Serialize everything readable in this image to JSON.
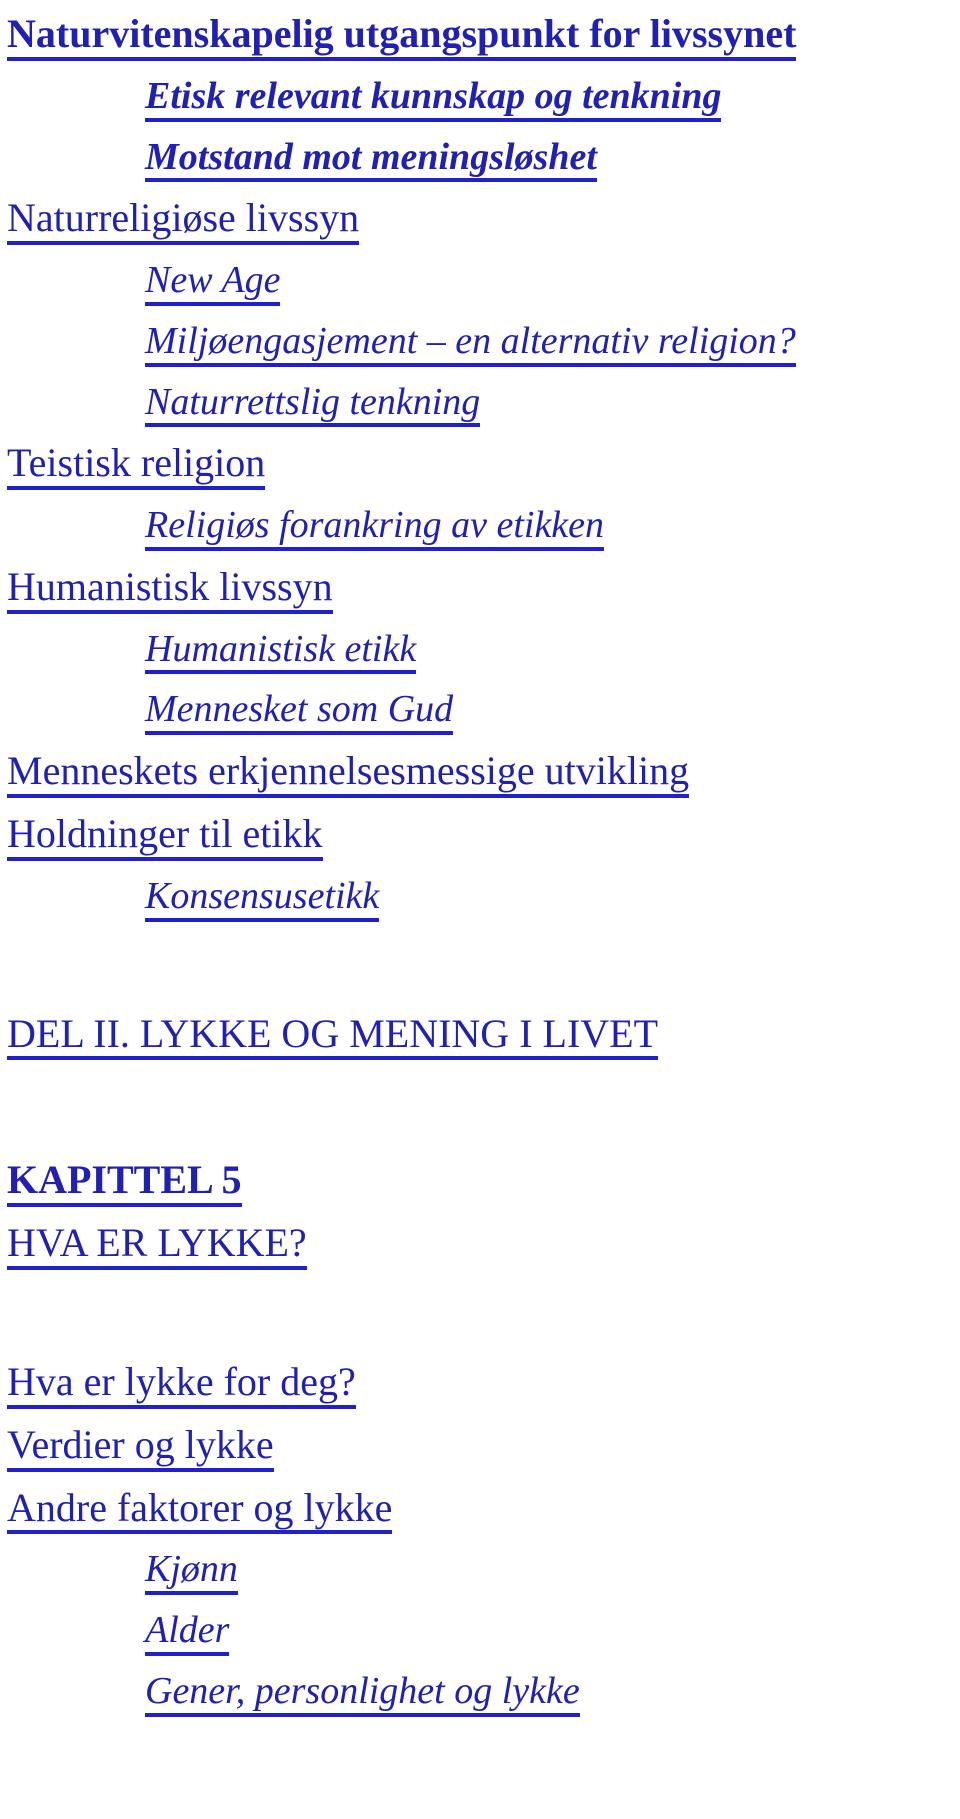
{
  "document": {
    "type": "table-of-contents",
    "language": "no",
    "text_color": "#2020b4",
    "underline_color": "#2020ce",
    "background_color": "#ffffff"
  },
  "entries": [
    {
      "text": "Naturvitenskapelig utgangspunkt for livssynet",
      "level": 0,
      "style": "bold",
      "gap": "first"
    },
    {
      "text": "Etisk relevant kunnskap og tenkning",
      "level": 1,
      "style": "bolditalic",
      "gap": "normal"
    },
    {
      "text": "Motstand mot meningsløshet",
      "level": 1,
      "style": "bolditalic",
      "gap": "normal"
    },
    {
      "text": "Naturreligiøse livssyn",
      "level": 0,
      "style": "normal",
      "gap": "normal"
    },
    {
      "text": "New Age",
      "level": 1,
      "style": "italic",
      "gap": "normal"
    },
    {
      "text": "Miljøengasjement – en alternativ religion?",
      "level": 1,
      "style": "italic",
      "gap": "normal"
    },
    {
      "text": "Naturrettslig tenkning",
      "level": 1,
      "style": "italic",
      "gap": "normal"
    },
    {
      "text": "Teistisk religion",
      "level": 0,
      "style": "normal",
      "gap": "normal"
    },
    {
      "text": "Religiøs forankring av etikken",
      "level": 1,
      "style": "italic",
      "gap": "normal"
    },
    {
      "text": "Humanistisk livssyn",
      "level": 0,
      "style": "normal",
      "gap": "normal"
    },
    {
      "text": "Humanistisk etikk",
      "level": 1,
      "style": "italic",
      "gap": "normal"
    },
    {
      "text": "Mennesket som Gud",
      "level": 1,
      "style": "italic",
      "gap": "normal"
    },
    {
      "text": "Menneskets erkjennelsesmessige utvikling",
      "level": 0,
      "style": "normal",
      "gap": "normal"
    },
    {
      "text": "Holdninger til etikk",
      "level": 0,
      "style": "normal",
      "gap": "normal"
    },
    {
      "text": "Konsensusetikk",
      "level": 1,
      "style": "italic",
      "gap": "normal"
    },
    {
      "text": "DEL II. LYKKE OG MENING I LIVET",
      "level": 0,
      "style": "normal",
      "gap": "big"
    },
    {
      "text": "KAPITTEL 5",
      "level": 0,
      "style": "bold",
      "gap": "huge"
    },
    {
      "text": "HVA ER LYKKE?",
      "level": 0,
      "style": "normal",
      "gap": "normal"
    },
    {
      "text": "Hva er lykke for deg?",
      "level": 0,
      "style": "normal",
      "gap": "big"
    },
    {
      "text": "Verdier og lykke",
      "level": 0,
      "style": "normal",
      "gap": "normal"
    },
    {
      "text": "Andre faktorer og lykke",
      "level": 0,
      "style": "normal",
      "gap": "normal"
    },
    {
      "text": "Kjønn",
      "level": 1,
      "style": "italic",
      "gap": "normal"
    },
    {
      "text": "Alder",
      "level": 1,
      "style": "italic",
      "gap": "normal"
    },
    {
      "text": "Gener, personlighet og lykke",
      "level": 1,
      "style": "italic",
      "gap": "normal"
    }
  ]
}
